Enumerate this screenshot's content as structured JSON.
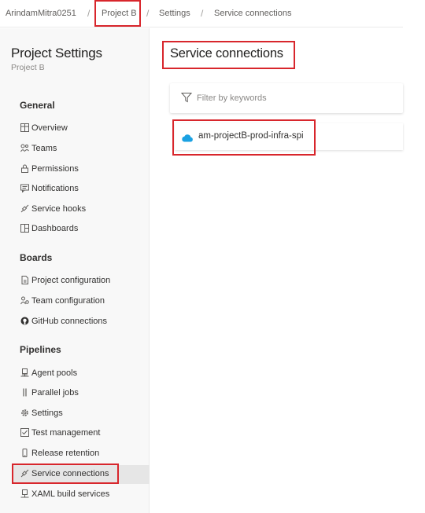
{
  "breadcrumb": {
    "items": [
      "ArindamMitra0251",
      "Project B",
      "Settings",
      "Service connections"
    ],
    "separator": "/"
  },
  "sidebar": {
    "title": "Project Settings",
    "subtitle": "Project B",
    "groups": [
      {
        "title": "General",
        "items": [
          {
            "label": "Overview",
            "icon": "overview-icon"
          },
          {
            "label": "Teams",
            "icon": "teams-icon"
          },
          {
            "label": "Permissions",
            "icon": "lock-icon"
          },
          {
            "label": "Notifications",
            "icon": "notifications-icon"
          },
          {
            "label": "Service hooks",
            "icon": "service-hooks-icon"
          },
          {
            "label": "Dashboards",
            "icon": "dashboards-icon"
          }
        ]
      },
      {
        "title": "Boards",
        "items": [
          {
            "label": "Project configuration",
            "icon": "document-icon"
          },
          {
            "label": "Team configuration",
            "icon": "team-config-icon"
          },
          {
            "label": "GitHub connections",
            "icon": "github-icon"
          }
        ]
      },
      {
        "title": "Pipelines",
        "items": [
          {
            "label": "Agent pools",
            "icon": "agent-pool-icon"
          },
          {
            "label": "Parallel jobs",
            "icon": "parallel-icon"
          },
          {
            "label": "Settings",
            "icon": "gear-icon"
          },
          {
            "label": "Test management",
            "icon": "test-icon"
          },
          {
            "label": "Release retention",
            "icon": "phone-icon"
          },
          {
            "label": "Service connections",
            "icon": "plug-icon",
            "selected": true
          },
          {
            "label": "XAML build services",
            "icon": "build-icon"
          }
        ]
      }
    ]
  },
  "main": {
    "title": "Service connections",
    "filter_placeholder": "Filter by keywords",
    "connections": [
      {
        "name": "am-projectB-prod-infra-spi",
        "icon": "azure-cloud-icon"
      }
    ]
  },
  "colors": {
    "highlight_box": "#d8262c",
    "azure_blue": "#0078d4",
    "selected_bg": "#e6e6e6"
  }
}
